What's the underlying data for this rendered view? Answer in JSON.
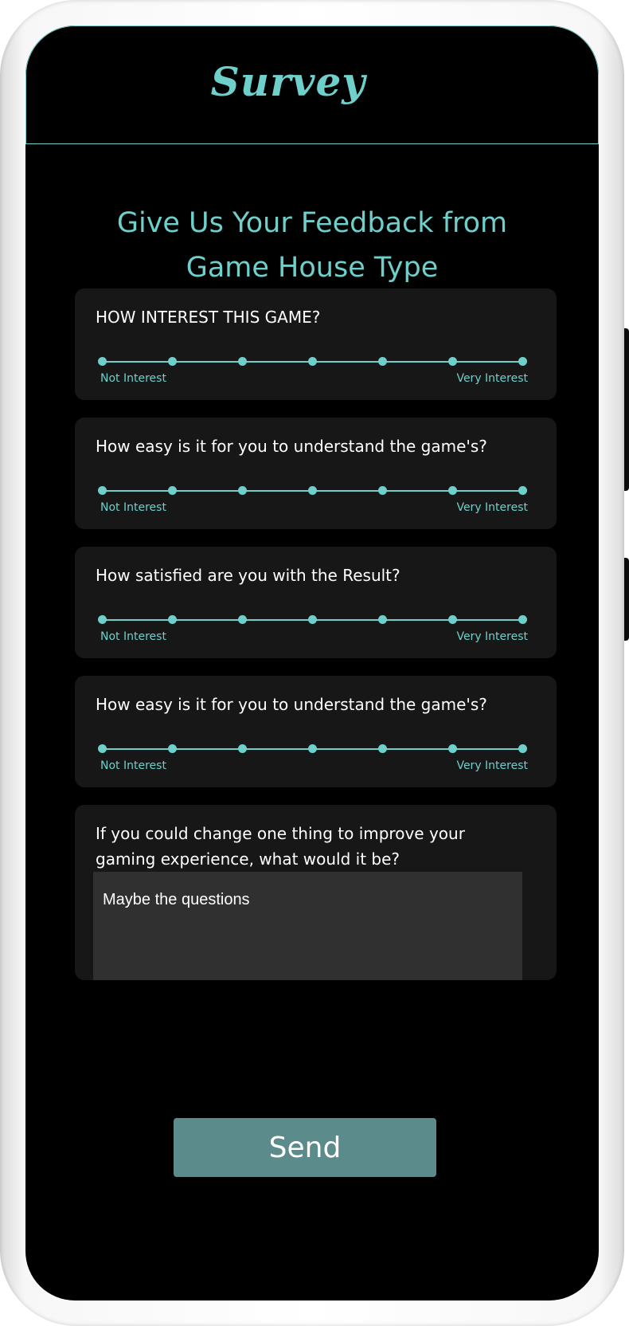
{
  "header": {
    "logo_text": "Survey"
  },
  "page": {
    "heading": "Give Us Your Feedback from Game House Type"
  },
  "questions": [
    {
      "label": "HOW INTEREST THIS GAME?",
      "scale_points": 7,
      "min_label": "Not Interest",
      "max_label": "Very Interest"
    },
    {
      "label": "How easy is it for you to understand the game's?",
      "scale_points": 7,
      "min_label": "Not Interest",
      "max_label": "Very Interest"
    },
    {
      "label": "How satisfied are you with the Result?",
      "scale_points": 7,
      "min_label": "Not Interest",
      "max_label": "Very Interest"
    },
    {
      "label": "How easy is it for you to understand the game's?",
      "scale_points": 7,
      "min_label": "Not Interest",
      "max_label": "Very Interest"
    }
  ],
  "open_question": {
    "label": "If you could change one thing to improve your gaming experience, what would it be?",
    "answer": "Maybe the questions"
  },
  "send_label": "Send",
  "colors": {
    "accent": "#6ecfcb",
    "background": "#000000",
    "card": "#171717",
    "input": "#303030",
    "button": "#5b8c8b"
  }
}
